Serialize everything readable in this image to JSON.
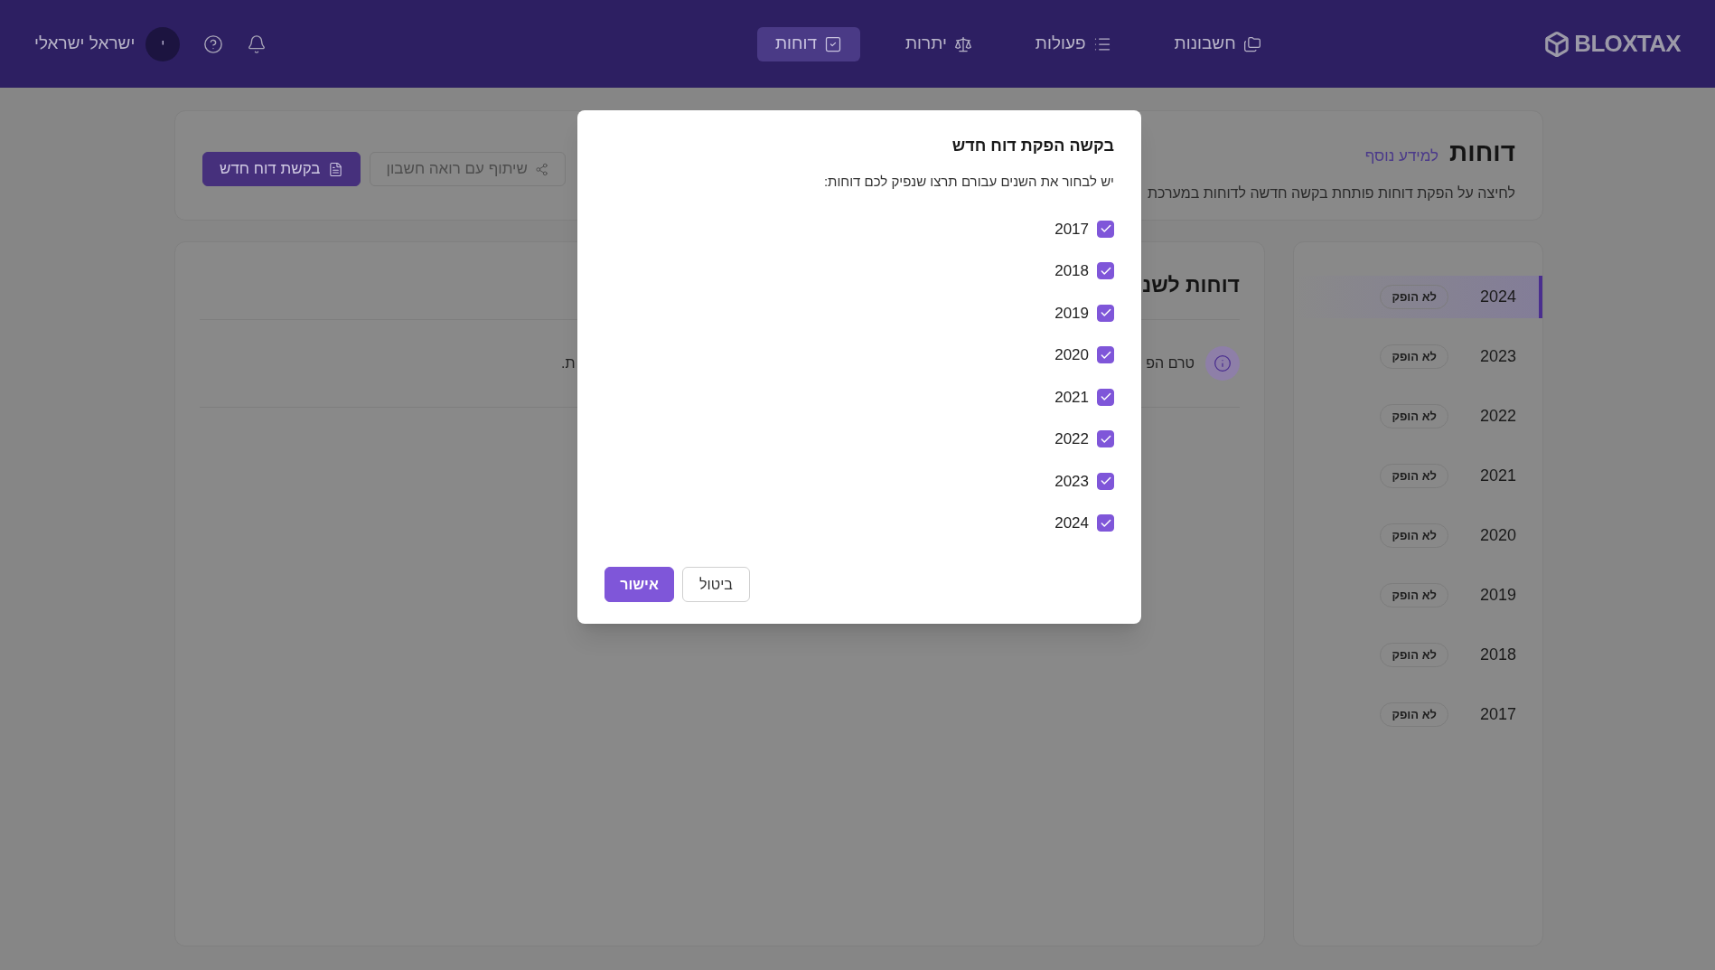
{
  "header": {
    "logo": "BLOXTAX",
    "nav": [
      {
        "label": "חשבונות",
        "selected": false
      },
      {
        "label": "פעולות",
        "selected": false
      },
      {
        "label": "יתרות",
        "selected": false
      },
      {
        "label": "דוחות",
        "selected": true
      }
    ],
    "user": {
      "initial": "י",
      "name": "ישראל ישראלי"
    }
  },
  "page": {
    "title": "דוחות",
    "info_link": "למידע נוסף",
    "description": "לחיצה על הפקת דוחות פותחת בקשה חדשה לדוחות במערכת",
    "buttons": [
      {
        "label": "שיתוף עם רואה חשבון",
        "kind": "outline",
        "disabled": true
      },
      {
        "label": "בקשת דוח חדש",
        "kind": "primary",
        "disabled": false
      }
    ]
  },
  "years": [
    {
      "year": "2024",
      "status": "לא הופק",
      "selected": true
    },
    {
      "year": "2023",
      "status": "לא הופק",
      "selected": false
    },
    {
      "year": "2022",
      "status": "לא הופק",
      "selected": false
    },
    {
      "year": "2021",
      "status": "לא הופק",
      "selected": false
    },
    {
      "year": "2020",
      "status": "לא הופק",
      "selected": false
    },
    {
      "year": "2019",
      "status": "לא הופק",
      "selected": false
    },
    {
      "year": "2018",
      "status": "לא הופק",
      "selected": false
    },
    {
      "year": "2017",
      "status": "לא הופק",
      "selected": false
    }
  ],
  "report_panel": {
    "title": "דוחות לשנ",
    "notice_start": "טרם הפ",
    "notice_end": "ת."
  },
  "dialog": {
    "title": "בקשה הפקת דוח חדש",
    "subtitle": "יש לבחור את השנים עבורם תרצו שנפיק לכם דוחות:",
    "options": [
      {
        "label": "2017",
        "checked": true
      },
      {
        "label": "2018",
        "checked": true
      },
      {
        "label": "2019",
        "checked": true
      },
      {
        "label": "2020",
        "checked": true
      },
      {
        "label": "2021",
        "checked": true
      },
      {
        "label": "2022",
        "checked": true
      },
      {
        "label": "2023",
        "checked": true
      },
      {
        "label": "2024",
        "checked": true
      }
    ],
    "buttons": [
      {
        "label": "ביטול",
        "kind": "secondary"
      },
      {
        "label": "אישור",
        "kind": "primary"
      }
    ]
  }
}
